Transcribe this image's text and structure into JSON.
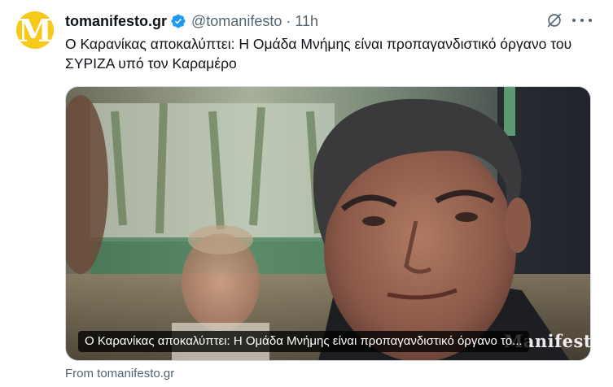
{
  "author": {
    "avatar_letter": "M",
    "avatar_color": "#f7c919",
    "display_name": "tomanifesto.gr",
    "verified_icon": "verified-badge-icon",
    "verified_color": "#1d9bf0",
    "handle": "@tomanifesto",
    "separator": "·",
    "time": "11h"
  },
  "actions": {
    "grok_icon": "grok-icon",
    "more_icon": "more-icon"
  },
  "tweet": {
    "text": "Ο Καρανίκας αποκαλύπτει: Η Ομάδα Μνήμης είναι προπαγανδιστικό όργανο του ΣΥΡΙΖΑ υπό τον Καραμέρο"
  },
  "card": {
    "caption": "Ο Καρανίκας αποκαλύπτει: Η Ομάδα Μνήμης είναι προπαγανδιστικό όργανο το...",
    "watermark": "Manifesto",
    "source": "From tomanifesto.gr"
  },
  "colors": {
    "text_primary": "#0f1419",
    "text_secondary": "#536471",
    "border": "#cfd9de"
  }
}
